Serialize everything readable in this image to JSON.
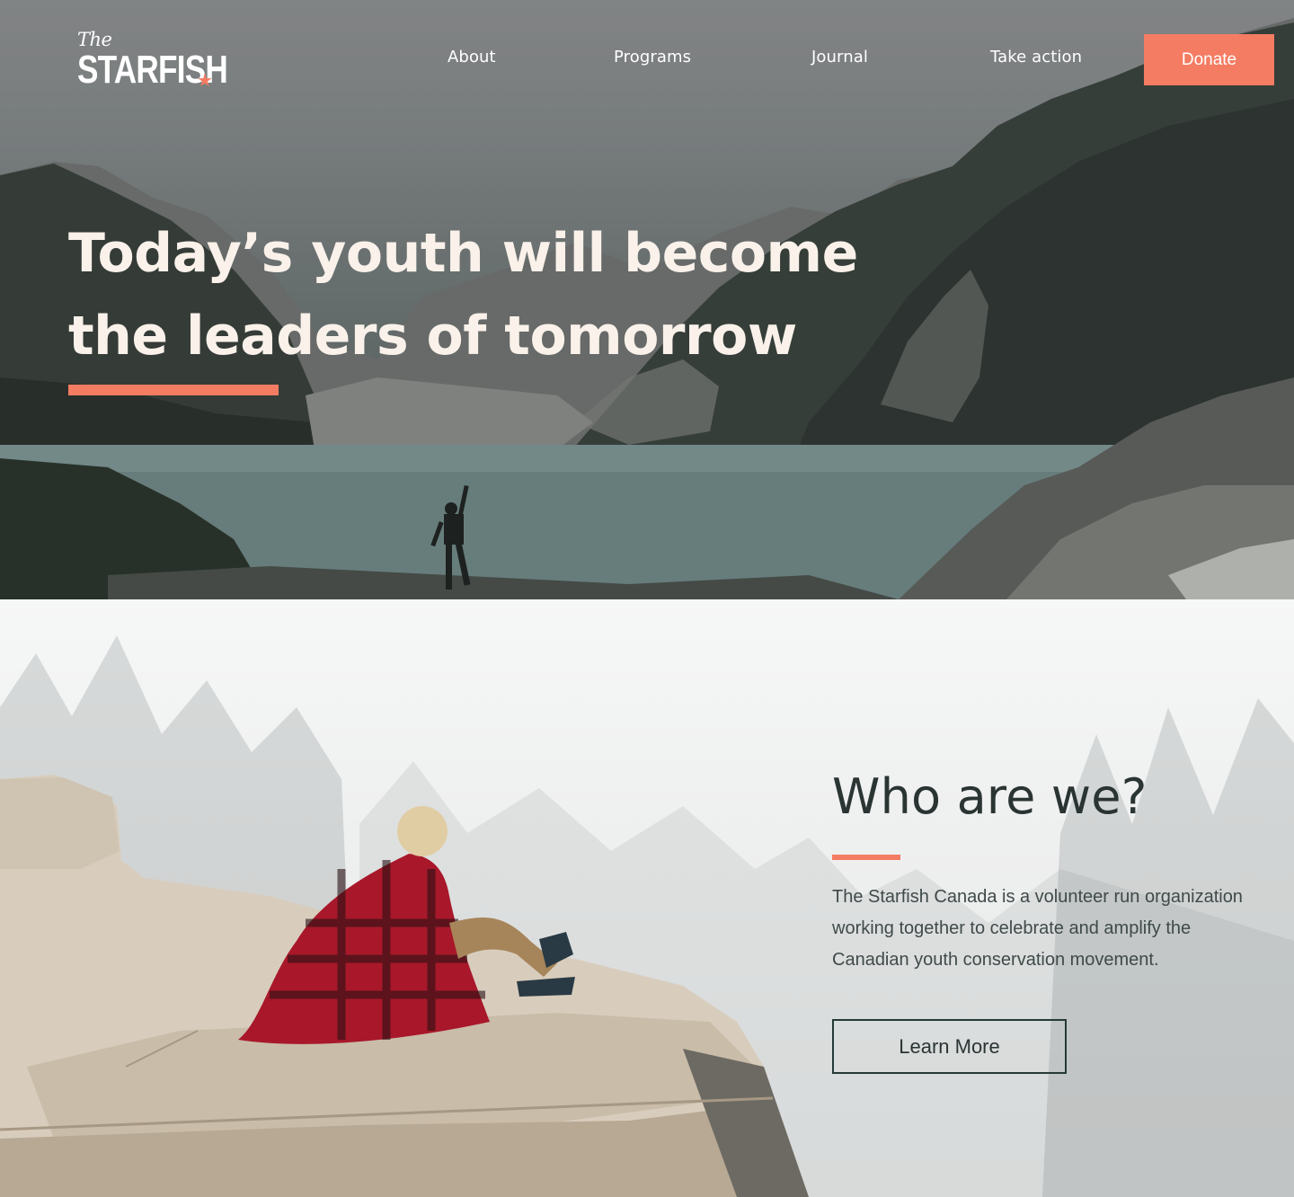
{
  "header": {
    "logo": {
      "top_text": "The",
      "name": "STARFISH",
      "star_glyph": "★"
    },
    "nav": [
      {
        "label": "About"
      },
      {
        "label": "Programs"
      },
      {
        "label": "Journal"
      },
      {
        "label": "Take action"
      }
    ],
    "donate_label": "Donate"
  },
  "hero": {
    "title_line1": "Today’s youth will become",
    "title_line2": "the leaders of tomorrow"
  },
  "about": {
    "title": "Who are we?",
    "text_line1": "The Starfish Canada is a volunteer run organization",
    "text_line2": "working together to celebrate and amplify the",
    "text_line3": "Canadian youth conservation movement.",
    "button_label": "Learn More"
  },
  "colors": {
    "accent": "#f47c62",
    "hero_text": "#f9f1ea",
    "dark_text": "#2a3433",
    "body_text": "#3f4a49",
    "button_border": "#243a38"
  },
  "icons": {
    "star": "star-icon"
  }
}
